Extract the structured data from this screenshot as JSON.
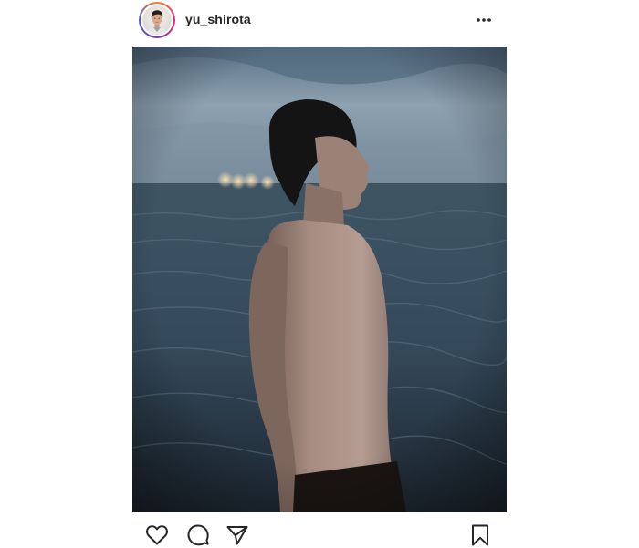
{
  "post": {
    "username": "yu_shirota"
  },
  "icons": {
    "more": "more-options-icon",
    "like": "heart-icon",
    "comment": "comment-icon",
    "share": "paper-plane-icon",
    "save": "bookmark-icon"
  },
  "colors": {
    "text": "#262626",
    "background": "#ffffff",
    "story_ring_start": "#f58529",
    "story_ring_end": "#515bd4"
  }
}
